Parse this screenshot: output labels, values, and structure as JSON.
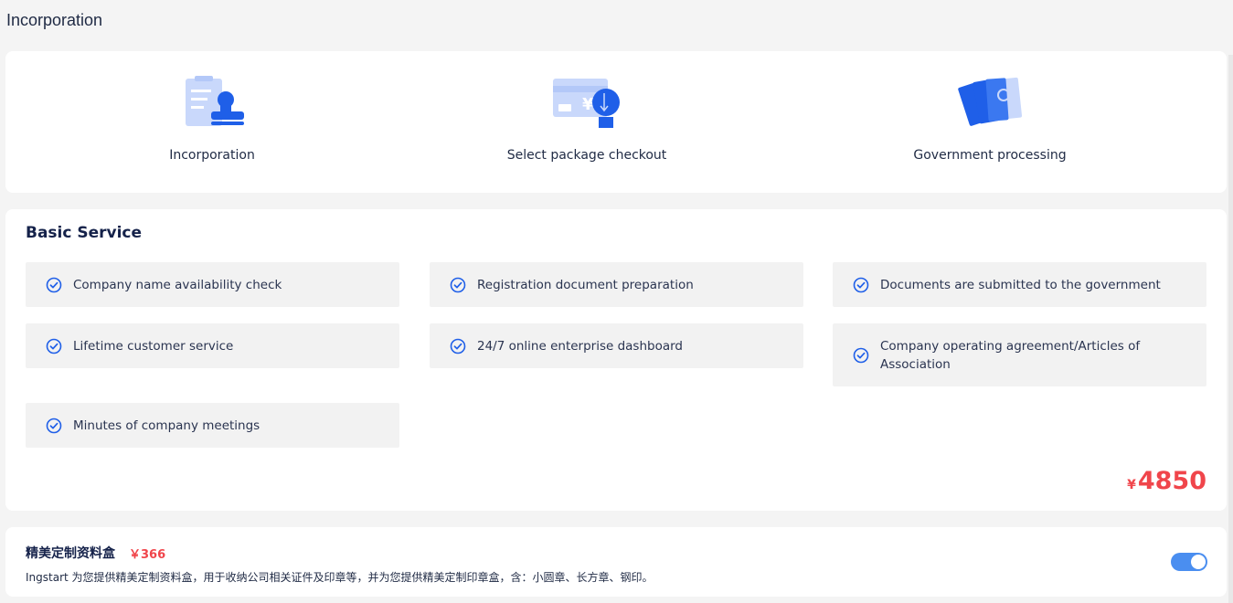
{
  "page": {
    "title": "Incorporation"
  },
  "steps": [
    {
      "label": "Incorporation",
      "icon": "document-stamp-icon"
    },
    {
      "label": "Select package checkout",
      "icon": "card-payment-icon"
    },
    {
      "label": "Government processing",
      "icon": "government-files-icon"
    }
  ],
  "service": {
    "title": "Basic Service",
    "features": [
      "Company name availability check",
      "Registration document preparation",
      "Documents are submitted to the government",
      "Lifetime customer service",
      "24/7 online enterprise dashboard",
      "Company operating agreement/Articles of Association",
      "Minutes of company meetings"
    ],
    "price": {
      "currency": "¥",
      "amount": "4850"
    }
  },
  "addon": {
    "name": "精美定制资料盒",
    "price": "￥366",
    "description": "Ingstart 为您提供精美定制资料盒，用于收纳公司相关证件及印章等，并为您提供精美定制印章盒，含：小圆章、长方章、钢印。",
    "enabled": true
  },
  "colors": {
    "accent": "#1f5fe8",
    "accent_light": "#c9d8fb",
    "price": "#f0454b",
    "toggle": "#4a8ef0"
  }
}
